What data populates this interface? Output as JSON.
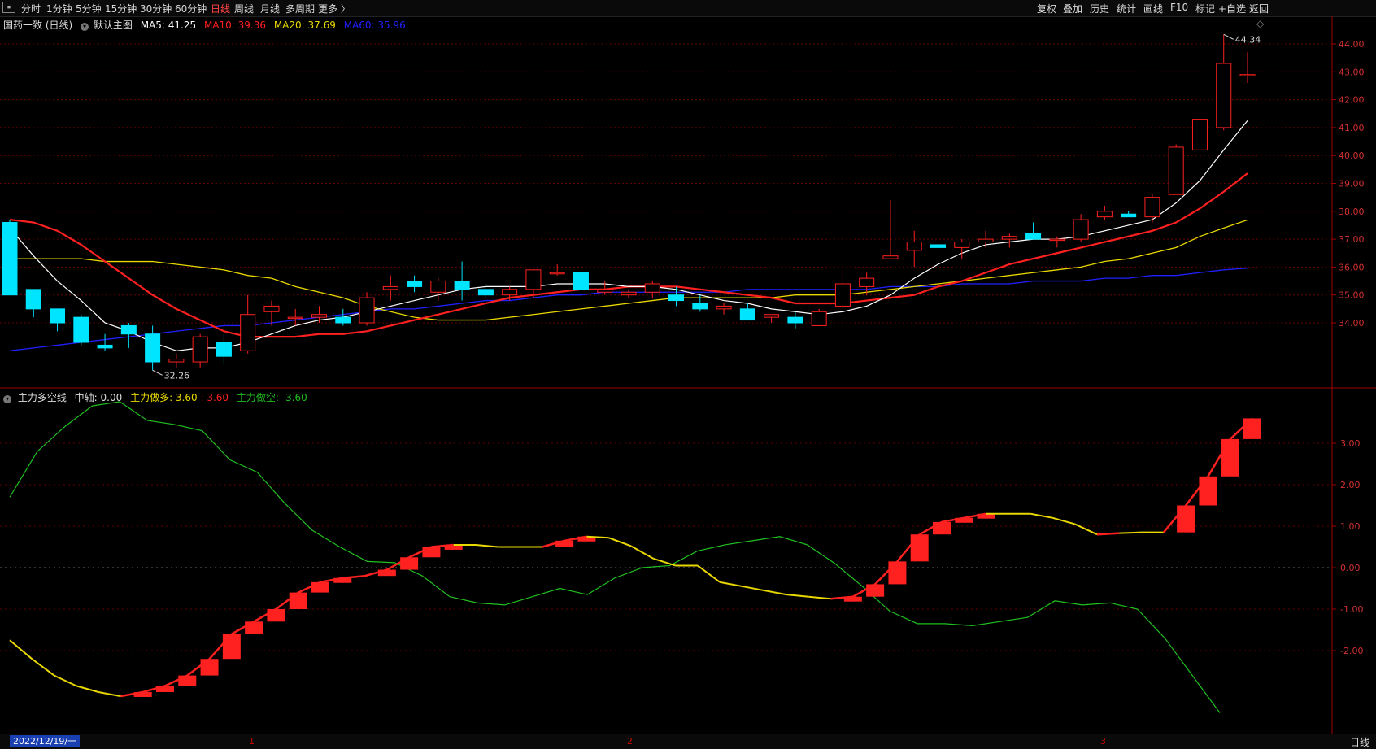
{
  "toolbar": {
    "left_items": [
      "分时",
      "1分钟",
      "5分钟",
      "15分钟",
      "30分钟",
      "60分钟",
      "日线",
      "周线",
      "月线",
      "多周期",
      "更多 〉"
    ],
    "active_item": "日线",
    "right_items": [
      "复权",
      "叠加",
      "历史",
      "统计",
      "画线",
      "F10",
      "标记",
      "+自选",
      "返回"
    ]
  },
  "main_panel": {
    "stock": "国药一致 (日线)",
    "template": "默认主图",
    "ma": [
      {
        "label": "MA5: 41.25",
        "color": "#ffffff"
      },
      {
        "label": "MA10: 39.36",
        "color": "#ff2020"
      },
      {
        "label": "MA20: 37.69",
        "color": "#e8d800"
      },
      {
        "label": "MA60: 35.96",
        "color": "#2020ff"
      }
    ],
    "high_label": "44.34",
    "low_label": "32.26",
    "y_ticks": [
      "44.00",
      "43.00",
      "42.00",
      "41.00",
      "40.00",
      "39.00",
      "38.00",
      "37.00",
      "36.00",
      "35.00",
      "34.00"
    ],
    "candles": [
      {
        "o": 37.6,
        "h": 37.7,
        "l": 35.0,
        "c": 35.0
      },
      {
        "o": 35.2,
        "h": 35.2,
        "l": 34.2,
        "c": 34.5
      },
      {
        "o": 34.5,
        "h": 34.5,
        "l": 33.7,
        "c": 34.0
      },
      {
        "o": 34.2,
        "h": 34.3,
        "l": 33.2,
        "c": 33.3
      },
      {
        "o": 33.2,
        "h": 33.6,
        "l": 33.0,
        "c": 33.1
      },
      {
        "o": 33.9,
        "h": 34.0,
        "l": 33.1,
        "c": 33.6
      },
      {
        "o": 33.6,
        "h": 33.9,
        "l": 32.3,
        "c": 32.6
      },
      {
        "o": 32.6,
        "h": 32.9,
        "l": 32.4,
        "c": 32.7
      },
      {
        "o": 32.6,
        "h": 33.6,
        "l": 32.4,
        "c": 33.5
      },
      {
        "o": 33.3,
        "h": 33.6,
        "l": 32.5,
        "c": 32.8
      },
      {
        "o": 33.0,
        "h": 35.0,
        "l": 32.9,
        "c": 34.3
      },
      {
        "o": 34.4,
        "h": 34.8,
        "l": 33.9,
        "c": 34.6
      },
      {
        "o": 34.2,
        "h": 34.5,
        "l": 33.9,
        "c": 34.2
      },
      {
        "o": 34.2,
        "h": 34.6,
        "l": 34.0,
        "c": 34.3
      },
      {
        "o": 34.2,
        "h": 34.5,
        "l": 33.9,
        "c": 34.0
      },
      {
        "o": 34.0,
        "h": 35.1,
        "l": 33.9,
        "c": 34.9
      },
      {
        "o": 35.2,
        "h": 35.7,
        "l": 34.8,
        "c": 35.3
      },
      {
        "o": 35.5,
        "h": 35.7,
        "l": 35.1,
        "c": 35.3
      },
      {
        "o": 35.1,
        "h": 35.6,
        "l": 34.8,
        "c": 35.5
      },
      {
        "o": 35.5,
        "h": 36.2,
        "l": 34.8,
        "c": 35.2
      },
      {
        "o": 35.2,
        "h": 35.4,
        "l": 34.9,
        "c": 35.0
      },
      {
        "o": 35.0,
        "h": 35.3,
        "l": 34.8,
        "c": 35.2
      },
      {
        "o": 35.2,
        "h": 35.9,
        "l": 34.9,
        "c": 35.9
      },
      {
        "o": 35.8,
        "h": 36.1,
        "l": 35.7,
        "c": 35.8
      },
      {
        "o": 35.8,
        "h": 35.9,
        "l": 35.0,
        "c": 35.2
      },
      {
        "o": 35.1,
        "h": 35.5,
        "l": 35.0,
        "c": 35.2
      },
      {
        "o": 35.0,
        "h": 35.2,
        "l": 34.9,
        "c": 35.1
      },
      {
        "o": 35.1,
        "h": 35.5,
        "l": 34.9,
        "c": 35.4
      },
      {
        "o": 35.0,
        "h": 35.3,
        "l": 34.6,
        "c": 34.8
      },
      {
        "o": 34.7,
        "h": 35.0,
        "l": 34.4,
        "c": 34.5
      },
      {
        "o": 34.5,
        "h": 34.7,
        "l": 34.3,
        "c": 34.6
      },
      {
        "o": 34.5,
        "h": 34.7,
        "l": 34.2,
        "c": 34.1
      },
      {
        "o": 34.2,
        "h": 34.3,
        "l": 34.0,
        "c": 34.3
      },
      {
        "o": 34.2,
        "h": 34.4,
        "l": 33.8,
        "c": 34.0
      },
      {
        "o": 33.9,
        "h": 34.5,
        "l": 33.9,
        "c": 34.4
      },
      {
        "o": 34.6,
        "h": 35.9,
        "l": 34.5,
        "c": 35.4
      },
      {
        "o": 35.3,
        "h": 35.8,
        "l": 35.0,
        "c": 35.6
      },
      {
        "o": 36.3,
        "h": 38.4,
        "l": 36.3,
        "c": 36.4
      },
      {
        "o": 36.6,
        "h": 37.3,
        "l": 36.0,
        "c": 36.9
      },
      {
        "o": 36.8,
        "h": 36.9,
        "l": 35.9,
        "c": 36.7
      },
      {
        "o": 36.7,
        "h": 37.0,
        "l": 36.3,
        "c": 36.9
      },
      {
        "o": 36.9,
        "h": 37.3,
        "l": 36.7,
        "c": 37.0
      },
      {
        "o": 37.0,
        "h": 37.2,
        "l": 36.7,
        "c": 37.1
      },
      {
        "o": 37.2,
        "h": 37.6,
        "l": 37.0,
        "c": 37.0
      },
      {
        "o": 37.0,
        "h": 37.1,
        "l": 36.7,
        "c": 37.0
      },
      {
        "o": 37.0,
        "h": 37.9,
        "l": 36.9,
        "c": 37.7
      },
      {
        "o": 37.8,
        "h": 38.2,
        "l": 37.7,
        "c": 38.0
      },
      {
        "o": 37.9,
        "h": 38.0,
        "l": 37.8,
        "c": 37.8
      },
      {
        "o": 37.8,
        "h": 38.6,
        "l": 37.6,
        "c": 38.5
      },
      {
        "o": 38.6,
        "h": 40.4,
        "l": 38.6,
        "c": 40.3
      },
      {
        "o": 40.2,
        "h": 41.4,
        "l": 40.2,
        "c": 41.3
      },
      {
        "o": 41.0,
        "h": 44.34,
        "l": 40.9,
        "c": 43.3
      },
      {
        "o": 42.9,
        "h": 43.7,
        "l": 42.6,
        "c": 42.9
      }
    ],
    "ma5": [
      37.4,
      36.4,
      35.5,
      34.8,
      34.0,
      33.7,
      33.3,
      33.0,
      33.1,
      33.1,
      33.3,
      33.6,
      33.9,
      34.1,
      34.2,
      34.4,
      34.6,
      34.8,
      35.0,
      35.2,
      35.3,
      35.3,
      35.3,
      35.4,
      35.4,
      35.4,
      35.3,
      35.3,
      35.2,
      35.0,
      34.8,
      34.7,
      34.5,
      34.4,
      34.3,
      34.4,
      34.6,
      35.0,
      35.6,
      36.1,
      36.5,
      36.8,
      36.9,
      37.0,
      37.0,
      37.1,
      37.3,
      37.5,
      37.7,
      38.3,
      39.1,
      40.2,
      41.25
    ],
    "ma10": [
      37.7,
      37.6,
      37.3,
      36.8,
      36.2,
      35.6,
      35.0,
      34.5,
      34.1,
      33.7,
      33.5,
      33.5,
      33.5,
      33.6,
      33.6,
      33.7,
      33.9,
      34.1,
      34.3,
      34.5,
      34.7,
      34.9,
      35.0,
      35.1,
      35.2,
      35.2,
      35.3,
      35.3,
      35.3,
      35.2,
      35.1,
      35.0,
      34.9,
      34.7,
      34.7,
      34.7,
      34.8,
      34.9,
      35.0,
      35.3,
      35.5,
      35.8,
      36.1,
      36.3,
      36.5,
      36.7,
      36.9,
      37.1,
      37.3,
      37.6,
      38.1,
      38.7,
      39.36
    ],
    "ma20": [
      36.3,
      36.3,
      36.3,
      36.3,
      36.2,
      36.2,
      36.2,
      36.1,
      36.0,
      35.9,
      35.7,
      35.6,
      35.3,
      35.1,
      34.9,
      34.6,
      34.4,
      34.2,
      34.1,
      34.1,
      34.1,
      34.2,
      34.3,
      34.4,
      34.5,
      34.6,
      34.7,
      34.8,
      34.9,
      34.9,
      34.9,
      34.9,
      34.9,
      35.0,
      35.0,
      35.0,
      35.1,
      35.2,
      35.3,
      35.4,
      35.5,
      35.6,
      35.7,
      35.8,
      35.9,
      36.0,
      36.2,
      36.3,
      36.5,
      36.7,
      37.1,
      37.4,
      37.69
    ],
    "ma60": [
      33.0,
      33.1,
      33.2,
      33.3,
      33.4,
      33.5,
      33.6,
      33.7,
      33.8,
      33.9,
      33.9,
      34.0,
      34.1,
      34.2,
      34.3,
      34.4,
      34.5,
      34.5,
      34.6,
      34.7,
      34.8,
      34.8,
      34.9,
      35.0,
      35.0,
      35.1,
      35.1,
      35.1,
      35.1,
      35.1,
      35.1,
      35.2,
      35.2,
      35.2,
      35.2,
      35.2,
      35.2,
      35.3,
      35.3,
      35.3,
      35.4,
      35.4,
      35.4,
      35.5,
      35.5,
      35.5,
      35.6,
      35.6,
      35.7,
      35.7,
      35.8,
      35.9,
      35.96
    ]
  },
  "sub_panel": {
    "name": "主力多空线",
    "mid_axis": "中轴: 0.00",
    "long_label": "主力做多: 3.60",
    "extra_label": ": 3.60",
    "short_label": "主力做空: -3.60",
    "y_ticks": [
      "3.00",
      "2.00",
      "1.00",
      "0.00",
      "-1.00",
      "-2.00"
    ],
    "long_line": [
      -1.75,
      -2.2,
      -2.6,
      -2.85,
      -3.0,
      -3.1,
      -3.0,
      -2.85,
      -2.6,
      -2.2,
      -1.6,
      -1.3,
      -1.0,
      -0.6,
      -0.35,
      -0.25,
      -0.2,
      -0.05,
      0.25,
      0.5,
      0.55,
      0.55,
      0.5,
      0.5,
      0.5,
      0.65,
      0.75,
      0.72,
      0.52,
      0.22,
      0.05,
      0.05,
      -0.35,
      -0.45,
      -0.55,
      -0.65,
      -0.7,
      -0.75,
      -0.7,
      -0.4,
      0.15,
      0.8,
      1.1,
      1.2,
      1.3,
      1.3,
      1.3,
      1.2,
      1.05,
      0.8,
      0.83,
      0.85,
      0.85,
      1.5,
      2.2,
      3.1,
      3.6
    ],
    "short_line": [
      1.7,
      2.8,
      3.4,
      3.9,
      4.0,
      3.55,
      3.45,
      3.3,
      2.6,
      2.3,
      1.55,
      0.9,
      0.5,
      0.15,
      0.12,
      -0.2,
      -0.7,
      -0.85,
      -0.9,
      -0.7,
      -0.5,
      -0.65,
      -0.25,
      0.0,
      0.05,
      0.4,
      0.55,
      0.65,
      0.75,
      0.55,
      0.1,
      -0.45,
      -1.05,
      -1.35,
      -1.35,
      -1.4,
      -1.3,
      -1.2,
      -0.8,
      -0.9,
      -0.85,
      -1.0,
      -1.7,
      -2.6,
      -3.5
    ]
  },
  "bottom": {
    "date": "2022/12/19/一",
    "months": [
      "1",
      "2",
      "3"
    ],
    "period": "日线"
  },
  "colors": {
    "up": "#ff2020",
    "down": "#00e5ff",
    "ma5": "#ffffff",
    "ma10": "#ff2020",
    "ma20": "#e8d800",
    "ma60": "#2020ff",
    "grid": "#600000",
    "green": "#20c020"
  }
}
